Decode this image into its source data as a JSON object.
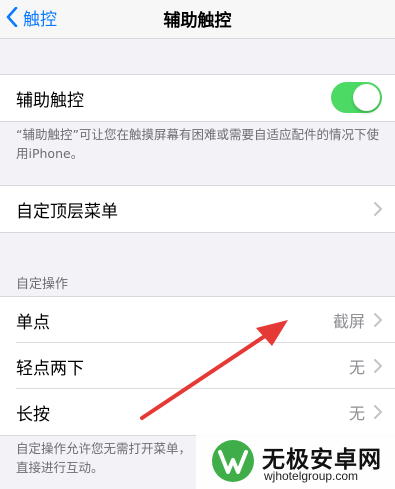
{
  "nav": {
    "back_label": "触控",
    "title": "辅助触控"
  },
  "assistive_touch": {
    "label": "辅助触控",
    "enabled": true,
    "accent": "#4cd964",
    "description": "“辅助触控”可让您在触摸屏幕有困难或需要自适应配件的情况下使用iPhone。"
  },
  "customize_menu": {
    "label": "自定顶层菜单"
  },
  "custom_actions": {
    "header": "自定操作",
    "rows": [
      {
        "label": "单点",
        "value": "截屏"
      },
      {
        "label": "轻点两下",
        "value": "无"
      },
      {
        "label": "长按",
        "value": "无"
      }
    ],
    "footer": "自定操作允许您无需打开菜单，直接进行互动。"
  },
  "watermark": {
    "name": "无极安卓网",
    "url": "wjhotelgroup.com"
  },
  "annotation_arrow": {
    "color": "#e53935",
    "icon": "red-arrow"
  }
}
